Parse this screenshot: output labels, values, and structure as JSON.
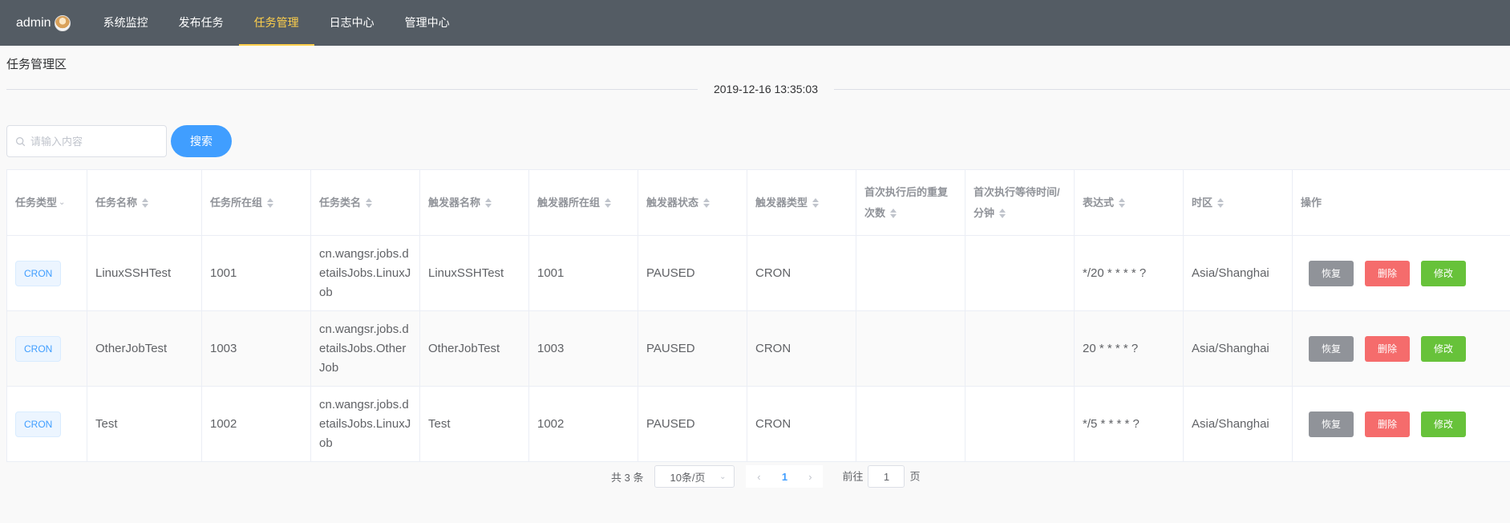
{
  "header": {
    "user": "admin",
    "nav": [
      {
        "label": "系统监控",
        "active": false
      },
      {
        "label": "发布任务",
        "active": false
      },
      {
        "label": "任务管理",
        "active": true
      },
      {
        "label": "日志中心",
        "active": false
      },
      {
        "label": "管理中心",
        "active": false
      }
    ]
  },
  "page": {
    "section_title": "任务管理区",
    "timestamp": "2019-12-16 13:35:03"
  },
  "search": {
    "placeholder": "请输入内容",
    "button": "搜索"
  },
  "table": {
    "columns": [
      "任务类型",
      "任务名称",
      "任务所在组",
      "任务类名",
      "触发器名称",
      "触发器所在组",
      "触发器状态",
      "触发器类型",
      "首次执行后的重复次数",
      "首次执行等待时间/分钟",
      "表达式",
      "时区",
      "操作"
    ],
    "rows": [
      {
        "type": "CRON",
        "name": "LinuxSSHTest",
        "group": "1001",
        "class": "cn.wangsr.jobs.detailsJobs.LinuxJob",
        "trigger_name": "LinuxSSHTest",
        "trigger_group": "1001",
        "trigger_state": "PAUSED",
        "trigger_type": "CRON",
        "repeat_count": "",
        "wait_minutes": "",
        "expression": "*/20 * * * * ?",
        "timezone": "Asia/Shanghai"
      },
      {
        "type": "CRON",
        "name": "OtherJobTest",
        "group": "1003",
        "class": "cn.wangsr.jobs.detailsJobs.OtherJob",
        "trigger_name": "OtherJobTest",
        "trigger_group": "1003",
        "trigger_state": "PAUSED",
        "trigger_type": "CRON",
        "repeat_count": "",
        "wait_minutes": "",
        "expression": "20 * * * * ?",
        "timezone": "Asia/Shanghai"
      },
      {
        "type": "CRON",
        "name": "Test",
        "group": "1002",
        "class": "cn.wangsr.jobs.detailsJobs.LinuxJob",
        "trigger_name": "Test",
        "trigger_group": "1002",
        "trigger_state": "PAUSED",
        "trigger_type": "CRON",
        "repeat_count": "",
        "wait_minutes": "",
        "expression": "*/5 * * * * ?",
        "timezone": "Asia/Shanghai"
      }
    ],
    "actions": {
      "restore": "恢复",
      "delete": "删除",
      "edit": "修改"
    }
  },
  "pagination": {
    "total": "共 3 条",
    "page_size": "10条/页",
    "current_page": "1",
    "goto_label": "前往",
    "goto_value": "1",
    "page_unit": "页"
  },
  "colors": {
    "topbar": "#545c64",
    "active_nav": "#ffd04b",
    "primary": "#409eff",
    "info": "#909399",
    "danger": "#f56c6c",
    "success": "#67c23a"
  }
}
